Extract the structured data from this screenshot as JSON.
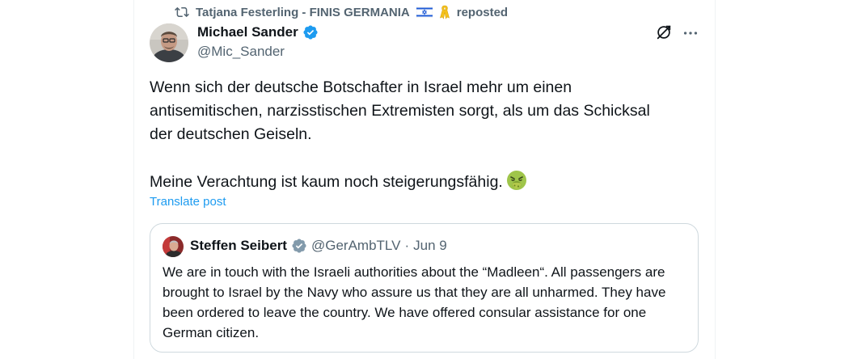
{
  "repost": {
    "icon": "repost-icon",
    "reposter_name": "Tatjana Festerling - FINIS GERMANIA",
    "label": "reposted"
  },
  "post": {
    "author_name": "Michael Sander",
    "author_handle": "@Mic_Sander",
    "text": "Wenn sich der deutsche Botschafter in Israel mehr um einen\nantisemitischen, narzisstischen Extremisten sorgt, als um das Schicksal\nder deutschen Geiseln.\n\nMeine Verachtung ist kaum noch steigerungsfähig.",
    "emoji": "face-vomiting-emoji",
    "translate_label": "Translate post"
  },
  "quote": {
    "author_name": "Steffen Seibert",
    "author_handle": "@GerAmbTLV",
    "separator": "·",
    "date": "Jun 9",
    "text": "We are in touch with the Israeli authorities about the “Madleen“. All passengers are brought to Israel by the Navy who assure us that they are all unharmed. They have been ordered to leave the country. We have offered consular assistance for one German citizen."
  },
  "colors": {
    "accent": "#1d9bf0",
    "secondary_text": "#536471",
    "border": "#cfd9de"
  }
}
